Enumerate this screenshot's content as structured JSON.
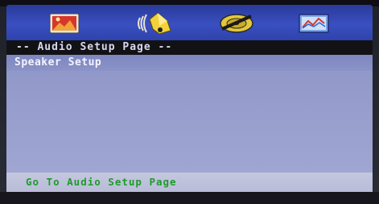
{
  "toolbar": {
    "icons": [
      {
        "name": "general-setup-icon"
      },
      {
        "name": "audio-setup-icon"
      },
      {
        "name": "dolby-setup-icon"
      },
      {
        "name": "preference-setup-icon"
      }
    ]
  },
  "page": {
    "title": "-- Audio Setup Page --"
  },
  "menu": {
    "items": [
      {
        "label": "Speaker Setup"
      }
    ]
  },
  "status": {
    "text": "Go To Audio Setup Page"
  },
  "colors": {
    "icon_bar": "#3a4fc0",
    "title_bar": "#121214",
    "menu_body": "#979ecd",
    "highlight": "#7d86c0",
    "status_text": "#1f9a2c"
  }
}
